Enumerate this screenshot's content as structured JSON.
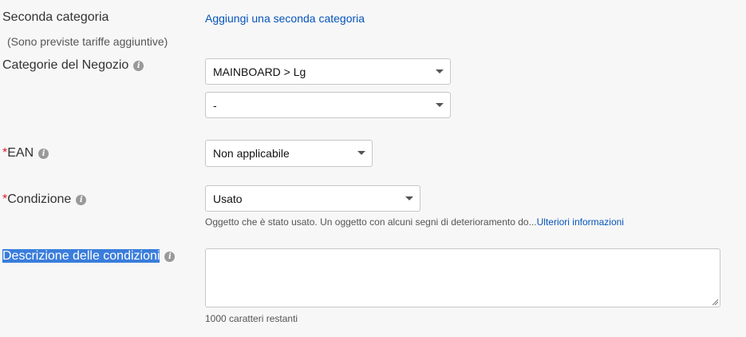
{
  "second_category": {
    "label": "Seconda categoria",
    "note": "(Sono previste tariffe aggiuntive)",
    "link": "Aggiungi una seconda categoria"
  },
  "store_categories": {
    "label": "Categorie del Negozio",
    "select1_value": "MAINBOARD > Lg",
    "select2_value": "-"
  },
  "ean": {
    "required_mark": "*",
    "label": "EAN",
    "value": "Non applicabile"
  },
  "condition": {
    "required_mark": "*",
    "label": "Condizione",
    "value": "Usato",
    "hint_text": "Oggetto che è stato usato. Un oggetto con alcuni segni di deterioramento do...",
    "hint_link": "Ulteriori informazioni"
  },
  "condition_description": {
    "label": "Descrizione delle condizioni",
    "value": "",
    "chars_remaining": "1000  caratteri restanti"
  },
  "icons": {
    "info": "info-icon",
    "dropdown": "chevron-down-icon",
    "resize": "resize-grip-icon"
  },
  "colors": {
    "link": "#0654ba",
    "required": "#dd1e31",
    "selection": "#3a7ddb"
  }
}
